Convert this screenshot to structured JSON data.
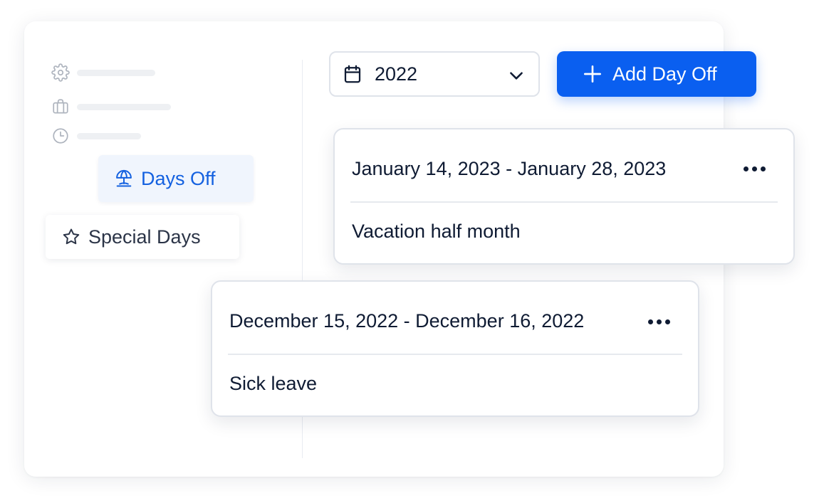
{
  "sidebar": {
    "icons": {
      "settings": "gear-icon",
      "work": "briefcase-icon",
      "time": "clock-icon",
      "days_off": "beach-umbrella-icon",
      "special_days": "star-icon"
    },
    "active_item": {
      "label": "Days Off"
    },
    "special_item": {
      "label": "Special Days"
    }
  },
  "toolbar": {
    "year_select": {
      "value": "2022",
      "icon": "calendar-icon",
      "chevron": "chevron-down-icon"
    },
    "add_button": {
      "label": "Add Day Off",
      "icon": "plus-icon"
    }
  },
  "days_off": [
    {
      "range": "January 14, 2023 - January 28, 2023",
      "note": "Vacation half month"
    },
    {
      "range": "December 15, 2022 - December 16, 2022",
      "note": "Sick leave"
    }
  ],
  "colors": {
    "accent": "#0a5ff0",
    "active_text": "#1461e0",
    "active_bg": "#f0f5fd",
    "text": "#0f1b33",
    "border": "#dfe3ea"
  }
}
